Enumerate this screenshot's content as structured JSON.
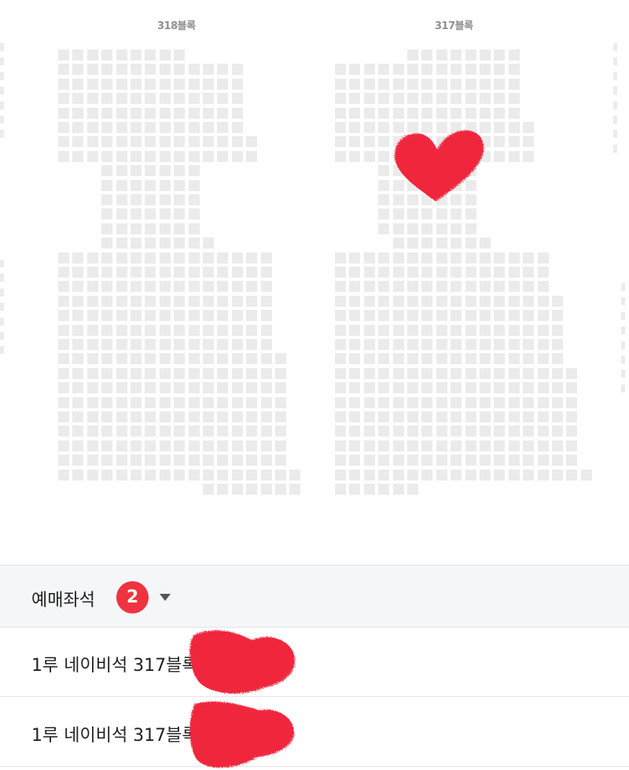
{
  "seatmap": {
    "blocks": [
      {
        "label": "318블록"
      },
      {
        "label": "317블록"
      }
    ],
    "seat_color": "#ebebeb",
    "mark_color": "#f0283c"
  },
  "selection": {
    "title": "예매좌석",
    "count": "2",
    "count_badge_color": "#ef3340",
    "header_bg": "#f5f6f8",
    "seats": [
      {
        "text": "1루 네이비석 317블록"
      },
      {
        "text": "1루 네이비석 317블록"
      }
    ]
  },
  "icons": {
    "dropdown": "caret-down-icon"
  }
}
